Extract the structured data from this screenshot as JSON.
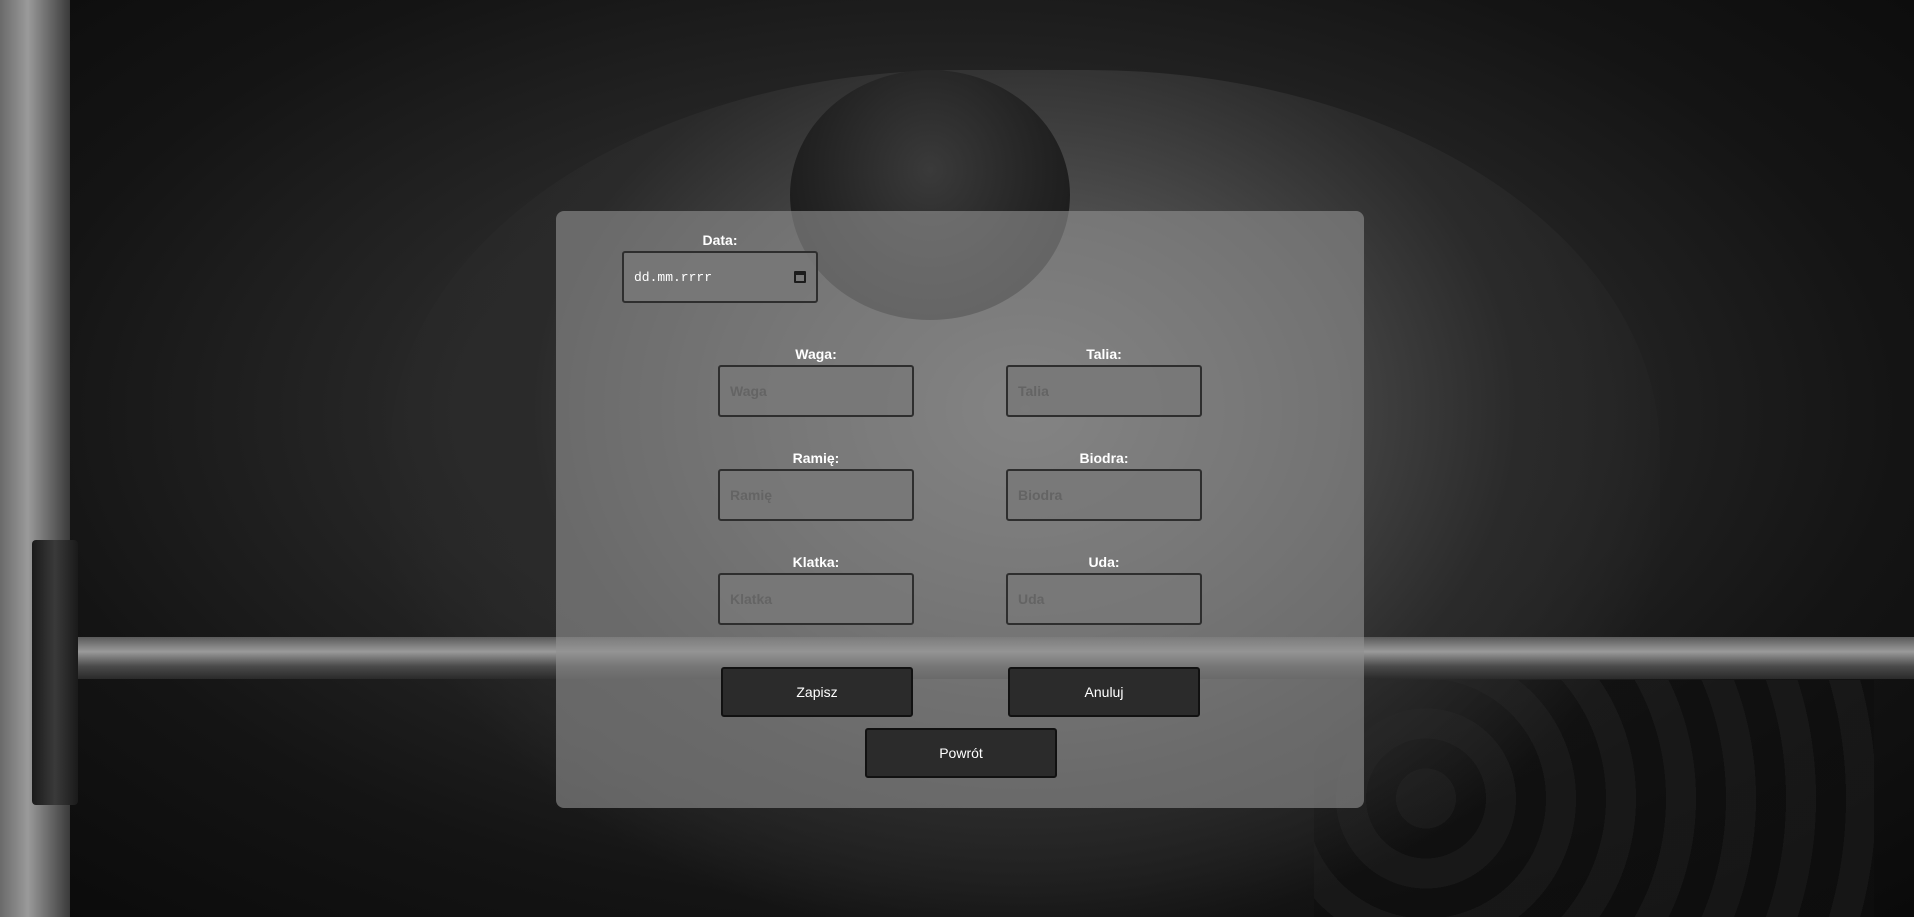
{
  "form": {
    "date": {
      "label": "Data:",
      "placeholder": "dd.mm.rrrr"
    },
    "waga": {
      "label": "Waga:",
      "placeholder": "Waga"
    },
    "talia": {
      "label": "Talia:",
      "placeholder": "Talia"
    },
    "ramie": {
      "label": "Ramię:",
      "placeholder": "Ramię"
    },
    "biodra": {
      "label": "Biodra:",
      "placeholder": "Biodra"
    },
    "klatka": {
      "label": "Klatka:",
      "placeholder": "Klatka"
    },
    "uda": {
      "label": "Uda:",
      "placeholder": "Uda"
    }
  },
  "buttons": {
    "save": "Zapisz",
    "cancel": "Anuluj",
    "back": "Powrót"
  },
  "icons": {
    "calendar": "calendar-icon"
  }
}
